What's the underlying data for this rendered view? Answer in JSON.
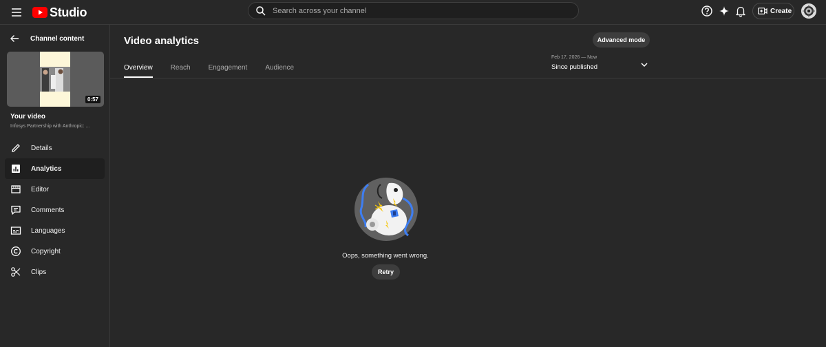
{
  "header": {
    "logo_text": "Studio",
    "search_placeholder": "Search across your channel",
    "create_label": "Create",
    "icons": [
      "menu-icon",
      "youtube-logo-icon",
      "search-icon",
      "help-icon",
      "sparkle-icon",
      "bell-icon",
      "create-video-icon",
      "avatar"
    ]
  },
  "sidebar": {
    "back_label": "Channel content",
    "thumbnail_duration": "0:57",
    "video_heading": "Your video",
    "video_title": "Infosys Partnership with Anthropic: ...",
    "items": [
      {
        "label": "Details",
        "icon": "pencil-icon",
        "active": false
      },
      {
        "label": "Analytics",
        "icon": "analytics-icon",
        "active": true
      },
      {
        "label": "Editor",
        "icon": "editor-icon",
        "active": false
      },
      {
        "label": "Comments",
        "icon": "comments-icon",
        "active": false
      },
      {
        "label": "Languages",
        "icon": "subtitles-icon",
        "active": false
      },
      {
        "label": "Copyright",
        "icon": "copyright-icon",
        "active": false
      },
      {
        "label": "Clips",
        "icon": "scissors-icon",
        "active": false
      }
    ]
  },
  "main": {
    "title": "Video analytics",
    "advanced_mode_label": "Advanced mode",
    "tabs": [
      {
        "label": "Overview",
        "active": true
      },
      {
        "label": "Reach",
        "active": false
      },
      {
        "label": "Engagement",
        "active": false
      },
      {
        "label": "Audience",
        "active": false
      }
    ],
    "date_range": {
      "range": "Feb 17, 2026 — Now",
      "label": "Since published"
    },
    "error": {
      "message": "Oops, something went wrong.",
      "retry_label": "Retry"
    }
  },
  "colors": {
    "background": "#282828",
    "youtube_red": "#ff0000",
    "active_item_bg": "#1f1f1f",
    "illustration_blue": "#3e7ef2",
    "illustration_yellow": "#f6c80f"
  }
}
